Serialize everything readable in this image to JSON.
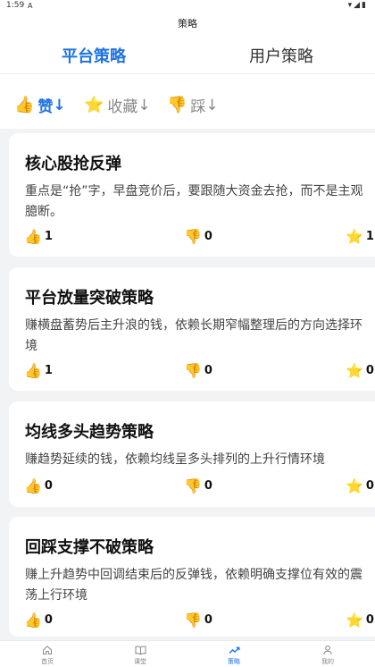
{
  "status": {
    "time": "1:59",
    "sim_icon": "A",
    "right_icons": "▾◢▮"
  },
  "appbar": {
    "title": "策略"
  },
  "tabs": [
    {
      "label": "平台策略",
      "active": true
    },
    {
      "label": "用户策略",
      "active": false
    }
  ],
  "sorts": [
    {
      "icon": "👍",
      "label": "赞",
      "arrow": "↓",
      "active": true
    },
    {
      "icon": "⭐",
      "label": "收藏",
      "arrow": "↓",
      "active": false
    },
    {
      "icon": "👎",
      "label": "踩",
      "arrow": "↓",
      "active": false
    }
  ],
  "icons": {
    "like": "👍",
    "dislike": "👎",
    "favorite": "⭐"
  },
  "strategies": [
    {
      "title": "核心股抢反弹",
      "desc": "重点是“抢”字，早盘竞价后，要跟随大资金去抢，而不是主观臆断。",
      "likes": "1",
      "dislikes": "0",
      "favorites": "1"
    },
    {
      "title": "平台放量突破策略",
      "desc": "赚横盘蓄势后主升浪的钱，依赖长期窄幅整理后的方向选择环境",
      "likes": "1",
      "dislikes": "0",
      "favorites": "0"
    },
    {
      "title": "均线多头趋势策略",
      "desc": "赚趋势延续的钱，依赖均线呈多头排列的上升行情环境",
      "likes": "0",
      "dislikes": "0",
      "favorites": "0"
    },
    {
      "title": "回踩支撑不破策略",
      "desc": "赚上升趋势中回调结束后的反弹钱，依赖明确支撑位有效的震荡上行环境",
      "likes": "0",
      "dislikes": "0",
      "favorites": "0"
    }
  ],
  "nav": [
    {
      "label": "首页",
      "icon": "home-icon",
      "active": false
    },
    {
      "label": "课堂",
      "icon": "book-icon",
      "active": false
    },
    {
      "label": "策略",
      "icon": "trend-icon",
      "active": true
    },
    {
      "label": "我的",
      "icon": "person-icon",
      "active": false
    }
  ],
  "colors": {
    "accent": "#1e73e6"
  }
}
